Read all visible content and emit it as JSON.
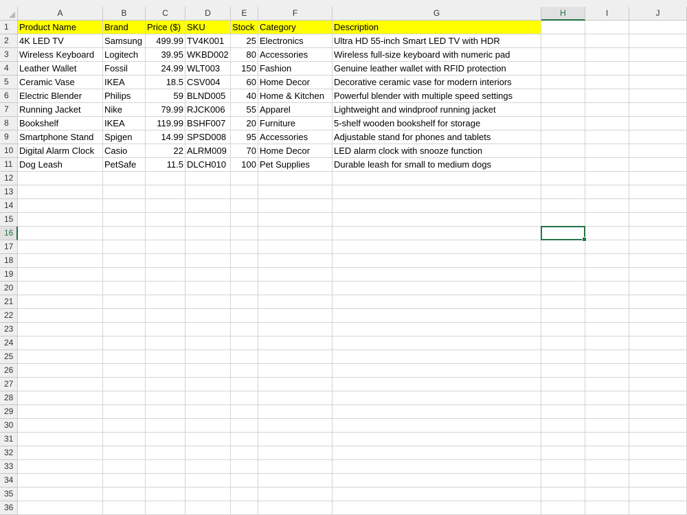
{
  "columns": [
    "A",
    "B",
    "C",
    "D",
    "E",
    "F",
    "G",
    "H",
    "I",
    "J"
  ],
  "selected_column": "H",
  "selected_row": 16,
  "row_numbers": [
    1,
    2,
    3,
    4,
    5,
    6,
    7,
    8,
    9,
    10,
    11,
    12,
    13,
    14,
    15,
    16,
    17,
    18,
    19,
    20,
    21,
    22,
    23,
    24,
    25,
    26,
    27,
    28,
    29,
    30,
    31,
    32,
    33,
    34,
    35,
    36
  ],
  "header_fill_color": "#ffff00",
  "selection_color": "#217346",
  "table": {
    "headers": [
      "Product Name",
      "Brand",
      "Price ($)",
      "SKU",
      "Stock",
      "Category",
      "Description"
    ],
    "rows": [
      [
        "4K LED TV",
        "Samsung",
        "499.99",
        "TV4K001",
        "25",
        "Electronics",
        "Ultra HD 55-inch Smart LED TV with HDR"
      ],
      [
        "Wireless Keyboard",
        "Logitech",
        "39.95",
        "WKBD002",
        "80",
        "Accessories",
        "Wireless full-size keyboard with numeric pad"
      ],
      [
        "Leather Wallet",
        "Fossil",
        "24.99",
        "WLT003",
        "150",
        "Fashion",
        "Genuine leather wallet with RFID protection"
      ],
      [
        "Ceramic Vase",
        "IKEA",
        "18.5",
        "CSV004",
        "60",
        "Home Decor",
        "Decorative ceramic vase for modern interiors"
      ],
      [
        "Electric Blender",
        "Philips",
        "59",
        "BLND005",
        "40",
        "Home & Kitchen",
        "Powerful blender with multiple speed settings"
      ],
      [
        "Running Jacket",
        "Nike",
        "79.99",
        "RJCK006",
        "55",
        "Apparel",
        "Lightweight and windproof running jacket"
      ],
      [
        "Bookshelf",
        "IKEA",
        "119.99",
        "BSHF007",
        "20",
        "Furniture",
        "5-shelf wooden bookshelf for storage"
      ],
      [
        "Smartphone Stand",
        "Spigen",
        "14.99",
        "SPSD008",
        "95",
        "Accessories",
        "Adjustable stand for phones and tablets"
      ],
      [
        "Digital Alarm Clock",
        "Casio",
        "22",
        "ALRM009",
        "70",
        "Home Decor",
        "LED alarm clock with snooze function"
      ],
      [
        "Dog Leash",
        "PetSafe",
        "11.5",
        "DLCH010",
        "100",
        "Pet Supplies",
        "Durable leash for small to medium dogs"
      ]
    ]
  }
}
